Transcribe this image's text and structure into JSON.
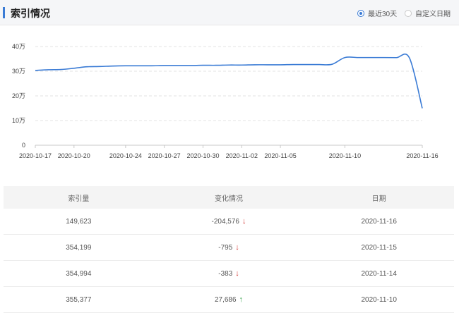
{
  "header": {
    "title": "索引情况",
    "range_options": [
      {
        "label": "最近30天",
        "selected": true
      },
      {
        "label": "自定义日期",
        "selected": false
      }
    ]
  },
  "chart_data": {
    "type": "line",
    "x": [
      "2020-10-17",
      "2020-10-18",
      "2020-10-19",
      "2020-10-20",
      "2020-10-21",
      "2020-10-22",
      "2020-10-23",
      "2020-10-24",
      "2020-10-25",
      "2020-10-26",
      "2020-10-27",
      "2020-10-28",
      "2020-10-29",
      "2020-10-30",
      "2020-10-31",
      "2020-11-01",
      "2020-11-02",
      "2020-11-03",
      "2020-11-04",
      "2020-11-05",
      "2020-11-06",
      "2020-11-07",
      "2020-11-08",
      "2020-11-09",
      "2020-11-10",
      "2020-11-11",
      "2020-11-12",
      "2020-11-13",
      "2020-11-14",
      "2020-11-15",
      "2020-11-16"
    ],
    "xticks": [
      "2020-10-17",
      "2020-10-20",
      "2020-10-24",
      "2020-10-27",
      "2020-10-30",
      "2020-11-02",
      "2020-11-05",
      "2020-11-10",
      "2020-11-16"
    ],
    "values": [
      303000,
      306000,
      307000,
      312000,
      318000,
      319000,
      321000,
      322000,
      322000,
      322000,
      323000,
      323000,
      323000,
      324000,
      324000,
      325000,
      325000,
      326000,
      326000,
      326000,
      327000,
      327000,
      327000,
      328000,
      355377,
      355377,
      355377,
      355377,
      354994,
      354199,
      149623
    ],
    "yticks": [
      {
        "value": 0,
        "label": "0"
      },
      {
        "value": 100000,
        "label": "10万"
      },
      {
        "value": 200000,
        "label": "20万"
      },
      {
        "value": 300000,
        "label": "30万"
      },
      {
        "value": 400000,
        "label": "40万"
      }
    ],
    "ylim": [
      0,
      400000
    ],
    "grid": true,
    "line_color": "#3a7bd5"
  },
  "table": {
    "columns": [
      "索引量",
      "变化情况",
      "日期"
    ],
    "rows": [
      {
        "count": "149,623",
        "change": "-204,576",
        "direction": "down",
        "date": "2020-11-16"
      },
      {
        "count": "354,199",
        "change": "-795",
        "direction": "down",
        "date": "2020-11-15"
      },
      {
        "count": "354,994",
        "change": "-383",
        "direction": "down",
        "date": "2020-11-14"
      },
      {
        "count": "355,377",
        "change": "27,686",
        "direction": "up",
        "date": "2020-11-10"
      }
    ]
  }
}
